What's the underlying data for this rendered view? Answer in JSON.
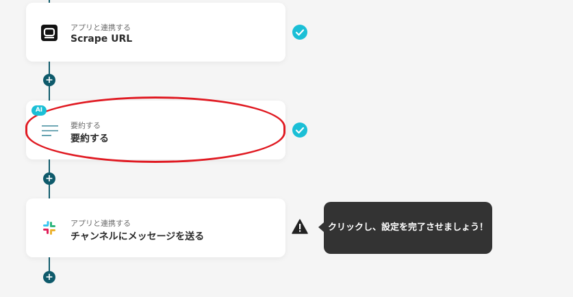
{
  "flow": {
    "steps": [
      {
        "subtitle": "アプリと連携する",
        "title": "Scrape URL",
        "icon": "scrape-url-app-icon",
        "status": "completed"
      },
      {
        "badge": "AI",
        "subtitle": "要約する",
        "title": "要約する",
        "icon": "summarize-lines-icon",
        "status": "completed",
        "highlighted": true
      },
      {
        "subtitle": "アプリと連携する",
        "title": "チャンネルにメッセージを送る",
        "icon": "slack-icon",
        "status": "warning"
      }
    ],
    "add_label": "+"
  },
  "tooltip": {
    "text": "クリックし、設定を完了させましょう！"
  },
  "colors": {
    "connector": "#0e5a6b",
    "check": "#1bbfd6",
    "highlight": "#e01a22",
    "tooltip_bg": "#333333"
  }
}
